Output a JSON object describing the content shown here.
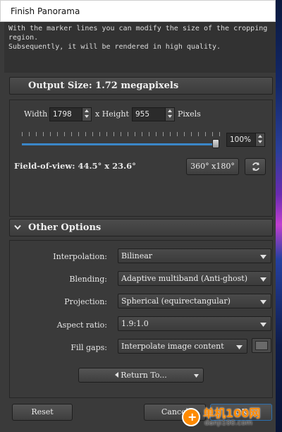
{
  "window": {
    "title": "Finish Panorama"
  },
  "info": {
    "line1": "With the marker lines you can modify the size of the cropping",
    "line2": "region.",
    "line3": "Subsequently, it will be rendered in high quality."
  },
  "output": {
    "header": "Output Size: 1.72 megapixels",
    "width_label": "Width",
    "width_value": "1798",
    "height_label": "x Height",
    "height_value": "955",
    "pixels_label": "Pixels",
    "zoom_value": "100%",
    "zoom_fraction": 0.95,
    "fov_text": "Field-of-view: 44.5° x 23.6°",
    "full_button": "360° x180°"
  },
  "other": {
    "header": "Other Options",
    "interpolation_label": "Interpolation:",
    "interpolation_value": "Bilinear",
    "blending_label": "Blending:",
    "blending_value": "Adaptive multiband (Anti-ghost)",
    "projection_label": "Projection:",
    "projection_value": "Spherical (equirectangular)",
    "aspect_label": "Aspect ratio:",
    "aspect_value": "1.9:1.0",
    "fill_label": "Fill gaps:",
    "fill_value": "Interpolate image content",
    "return_button": "Return To..."
  },
  "footer": {
    "reset": "Reset",
    "cancel": "Cancel",
    "ok": "OK"
  },
  "watermark": {
    "text": "单机100网",
    "url": "danji100.com"
  },
  "colors": {
    "accent": "#3a86c8",
    "watermark": "#ff8a00"
  }
}
